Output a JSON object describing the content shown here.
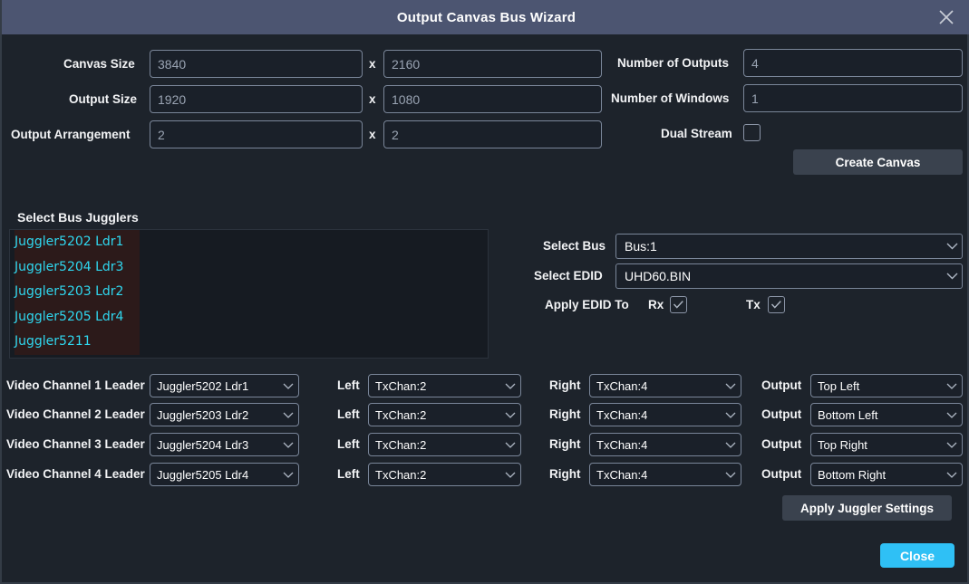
{
  "window": {
    "title": "Output Canvas Bus Wizard",
    "close_icon": "close-icon"
  },
  "canvas_form": {
    "canvas_size_label": "Canvas Size",
    "canvas_width": "3840",
    "canvas_height": "2160",
    "output_size_label": "Output Size",
    "output_width": "1920",
    "output_height": "1080",
    "output_arrangement_label": "Output Arrangement",
    "arrangement_cols": "2",
    "arrangement_rows": "2",
    "multiply_symbol": "x",
    "number_of_outputs_label": "Number of Outputs",
    "number_of_outputs": "4",
    "number_of_windows_label": "Number of Windows",
    "number_of_windows": "1",
    "dual_stream_label": "Dual Stream",
    "dual_stream_checked": false,
    "create_canvas_label": "Create Canvas"
  },
  "bus_jugglers": {
    "section_label": "Select Bus Jugglers",
    "items": [
      {
        "label": "Juggler5202 Ldr1"
      },
      {
        "label": "Juggler5204 Ldr3"
      },
      {
        "label": "Juggler5203 Ldr2"
      },
      {
        "label": "Juggler5205 Ldr4"
      },
      {
        "label": "Juggler5211"
      }
    ]
  },
  "bus_panel": {
    "select_bus_label": "Select Bus",
    "select_bus_value": "Bus:1",
    "select_edid_label": "Select EDID",
    "select_edid_value": "UHD60.BIN",
    "apply_edid_to_label": "Apply EDID To",
    "rx_label": "Rx",
    "rx_checked": true,
    "tx_label": "Tx",
    "tx_checked": true
  },
  "channels": {
    "left_label": "Left",
    "right_label": "Right",
    "output_label": "Output",
    "rows": [
      {
        "leader_label": "Video Channel 1 Leader",
        "leader_value": "Juggler5202 Ldr1",
        "left_value": "TxChan:2",
        "right_value": "TxChan:4",
        "output_value": "Top Left"
      },
      {
        "leader_label": "Video Channel 2 Leader",
        "leader_value": "Juggler5203 Ldr2",
        "left_value": "TxChan:2",
        "right_value": "TxChan:4",
        "output_value": "Bottom Left"
      },
      {
        "leader_label": "Video Channel 3 Leader",
        "leader_value": "Juggler5204 Ldr3",
        "left_value": "TxChan:2",
        "right_value": "TxChan:4",
        "output_value": "Top Right"
      },
      {
        "leader_label": "Video Channel 4 Leader",
        "leader_value": "Juggler5205 Ldr4",
        "left_value": "TxChan:2",
        "right_value": "TxChan:4",
        "output_value": "Bottom Right"
      }
    ]
  },
  "footer": {
    "apply_juggler_settings_label": "Apply Juggler Settings",
    "close_label": "Close"
  },
  "colors": {
    "titlebar": "#4c5571",
    "window_bg": "#1d232b",
    "accent": "#2fc0f5",
    "juggler_text": "#2fd8f0",
    "highlight": "#2c1a1a"
  }
}
